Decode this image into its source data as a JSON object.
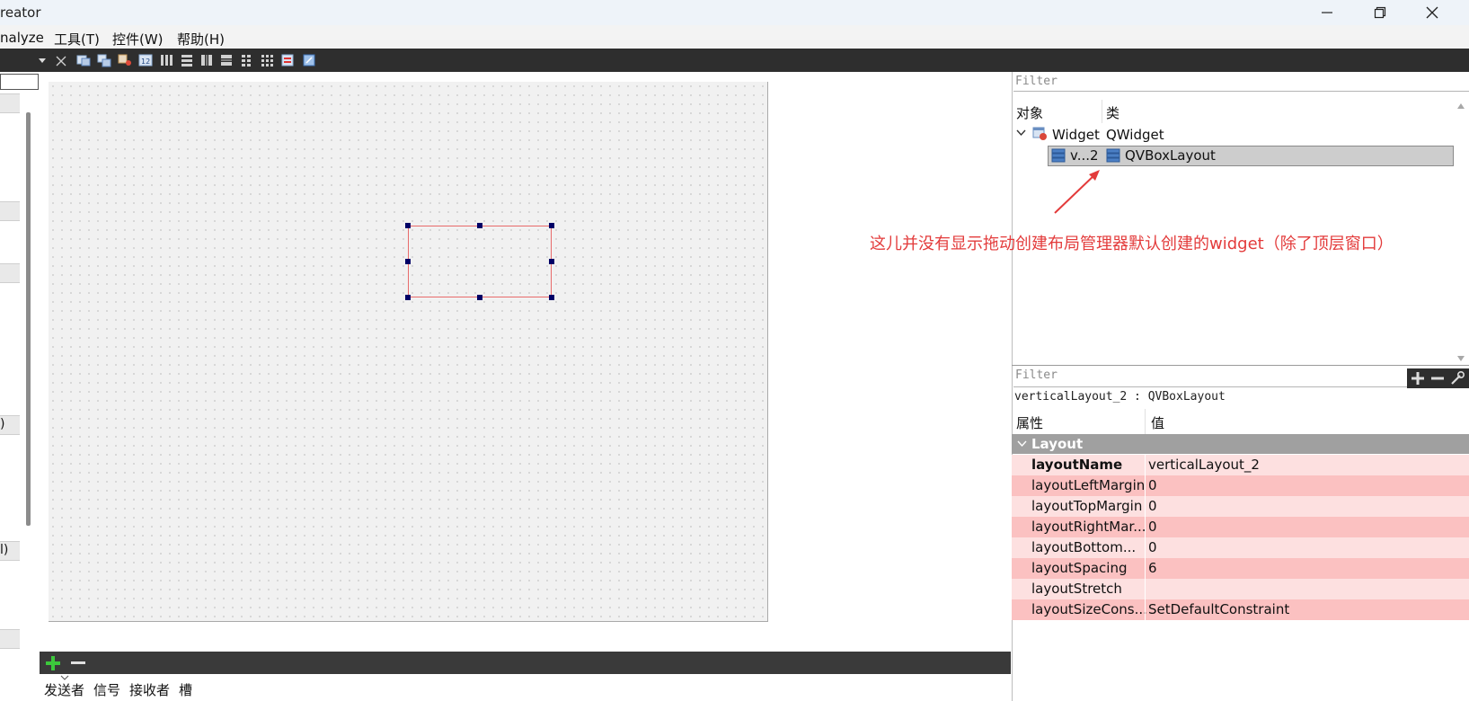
{
  "title_bar": {
    "app_title": "reator",
    "min_icon": "minimize-icon",
    "max_icon": "restore-icon",
    "close_icon": "close-icon"
  },
  "menu": {
    "items": [
      "nalyze",
      "工具(T)",
      "控件(W)",
      "帮助(H)"
    ]
  },
  "left_dock": {
    "fragments": [
      ")",
      "l)"
    ]
  },
  "object_inspector": {
    "filter_placeholder": "Filter",
    "columns": [
      "对象",
      "类"
    ],
    "rows": [
      {
        "object": "Widget",
        "class": "QWidget",
        "icon": "widget-icon"
      },
      {
        "object": "v...2",
        "class": "QVBoxLayout",
        "icon": "vboxlayout-icon"
      }
    ]
  },
  "annotation": {
    "text": "这儿并没有显示拖动创建布局管理器默认创建的widget（除了顶层窗口）",
    "color": "#e33b3b"
  },
  "property_editor": {
    "filter_placeholder": "Filter",
    "object_label": "verticalLayout_2 : QVBoxLayout",
    "columns": [
      "属性",
      "值"
    ],
    "group": "Layout",
    "rows": [
      {
        "name": "layoutName",
        "value": "verticalLayout_2"
      },
      {
        "name": "layoutLeftMargin",
        "value": "0"
      },
      {
        "name": "layoutTopMargin",
        "value": "0"
      },
      {
        "name": "layoutRightMar...",
        "value": "0"
      },
      {
        "name": "layoutBottom...",
        "value": "0"
      },
      {
        "name": "layoutSpacing",
        "value": "6"
      },
      {
        "name": "layoutStretch",
        "value": ""
      },
      {
        "name": "layoutSizeCons...",
        "value": "SetDefaultConstraint"
      }
    ],
    "row_colors": [
      "#fde0e0",
      "#fbc1c1"
    ],
    "group_color": "#a0a0a0"
  },
  "signal_slot_editor": {
    "columns": [
      "发送者",
      "信号",
      "接收者",
      "槽"
    ]
  }
}
